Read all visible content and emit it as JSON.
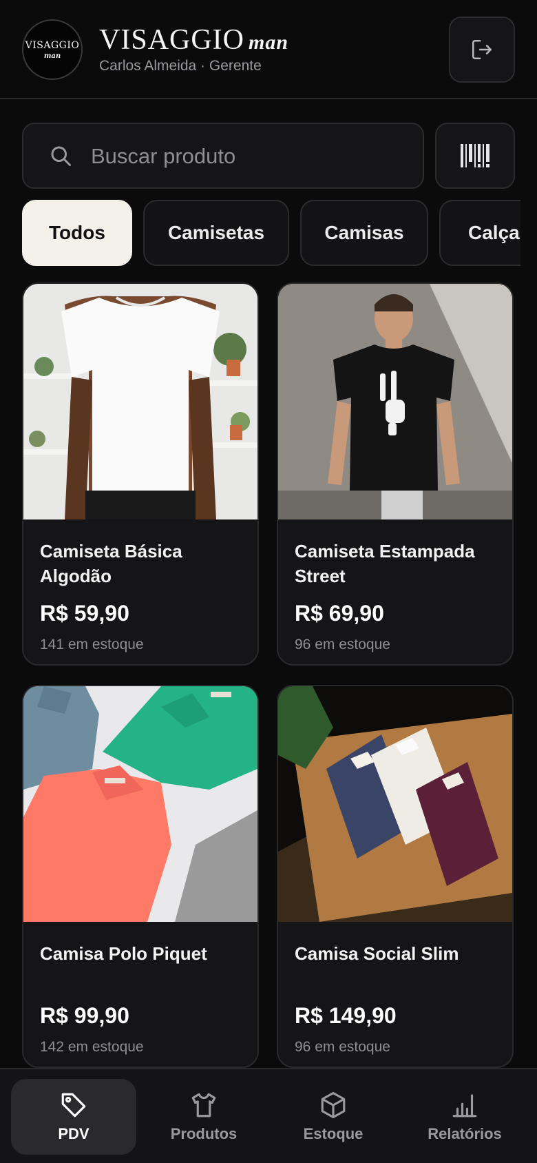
{
  "header": {
    "logo": {
      "word": "VISAGGIO",
      "sub": "man"
    },
    "brand_name": "VISAGGIO",
    "brand_suffix": "man",
    "user_line": "Carlos Almeida · Gerente",
    "logout_icon": "logout-icon"
  },
  "search": {
    "placeholder": "Buscar produto",
    "value": "",
    "icon": "search-icon",
    "scan_icon": "barcode-icon"
  },
  "categories": [
    "Todos",
    "Camisetas",
    "Camisas",
    "Calças"
  ],
  "active_category": "Todos",
  "products": [
    {
      "name": "Camiseta Básica Algodão",
      "price": "R$ 59,90",
      "stock": "141 em estoque"
    },
    {
      "name": "Camiseta Estampada Street",
      "price": "R$ 69,90",
      "stock": "96 em estoque"
    },
    {
      "name": "Camisa Polo Piquet",
      "price": "R$ 99,90",
      "stock": "142 em estoque"
    },
    {
      "name": "Camisa Social Slim",
      "price": "R$ 149,90",
      "stock": "96 em estoque"
    }
  ],
  "nav": [
    {
      "label": "PDV",
      "icon": "tag-icon",
      "active": true
    },
    {
      "label": "Produtos",
      "icon": "shirt-icon",
      "active": false
    },
    {
      "label": "Estoque",
      "icon": "box-icon",
      "active": false
    },
    {
      "label": "Relatórios",
      "icon": "bar-chart-icon",
      "active": false
    }
  ],
  "colors": {
    "background": "#0b0b0c",
    "surface": "#151517",
    "active_chip": "#f3f1ea",
    "muted_text": "#8e8e93"
  }
}
